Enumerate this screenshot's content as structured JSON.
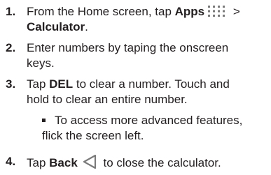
{
  "steps": [
    {
      "number": "1.",
      "line1_pre": "From the Home screen, tap ",
      "line1_bold": "Apps",
      "line1_post": " >",
      "line2_bold": "Calculator",
      "line2_post": "."
    },
    {
      "number": "2.",
      "line1": "Enter numbers by taping the onscreen",
      "line2": "keys."
    },
    {
      "number": "3.",
      "line1_pre": "Tap ",
      "line1_bold": "DEL",
      "line1_post": " to clear a number. Touch and",
      "line2": "hold to clear an entire number."
    },
    {
      "number": "4.",
      "pre": "Tap ",
      "bold": "Back",
      "post": " to close the calculator."
    }
  ],
  "sub_bullet": {
    "line1": "To access more advanced features,",
    "line2": "flick the screen left."
  },
  "icons": {
    "apps": "apps-grid-icon",
    "back": "back-triangle-icon"
  },
  "colors": {
    "text": "#231f20",
    "icon": "#7a7a7a"
  }
}
